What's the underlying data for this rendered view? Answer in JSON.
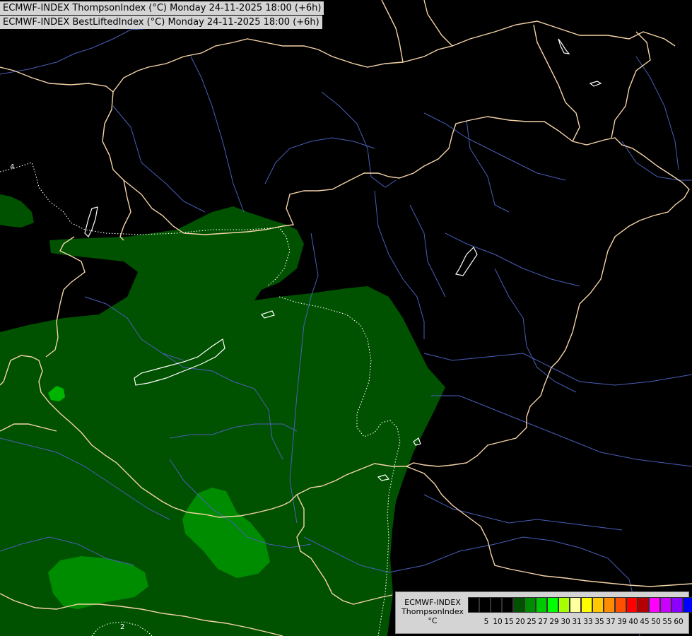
{
  "titles": {
    "line1": "ECMWF-INDEX ThompsonIndex (°C) Monday 24-11-2025 18:00 (+6h)",
    "line2": "ECMWF-INDEX BestLiftedIndex (°C) Monday 24-11-2025 18:00 (+6h)"
  },
  "legend": {
    "model": "ECMWF-INDEX",
    "parameter": "ThompsonIndex",
    "unit": "°C",
    "ticks": [
      "5",
      "10",
      "15",
      "20",
      "25",
      "27",
      "29",
      "30",
      "31",
      "33",
      "35",
      "37",
      "39",
      "40",
      "45",
      "50",
      "55",
      "60"
    ],
    "colors": [
      "#000000",
      "#000000",
      "#000000",
      "#000000",
      "#005200",
      "#008c00",
      "#00c800",
      "#00ff00",
      "#a8ff00",
      "#ffffa0",
      "#ffff00",
      "#ffc800",
      "#ff8c00",
      "#ff5000",
      "#ff0000",
      "#b40000",
      "#ff00ff",
      "#c800ff",
      "#8c00ff",
      "#0000ff"
    ]
  },
  "contour_labels": {
    "top_left": "4",
    "bottom_left": "2"
  },
  "colors": {
    "background": "#000000",
    "field_dark_green": "#005200",
    "field_green": "#008c00",
    "field_light_green": "#00c800",
    "borders": "#f5d3a8",
    "rivers": "#4a5fb8",
    "contours": "#ffffff"
  }
}
